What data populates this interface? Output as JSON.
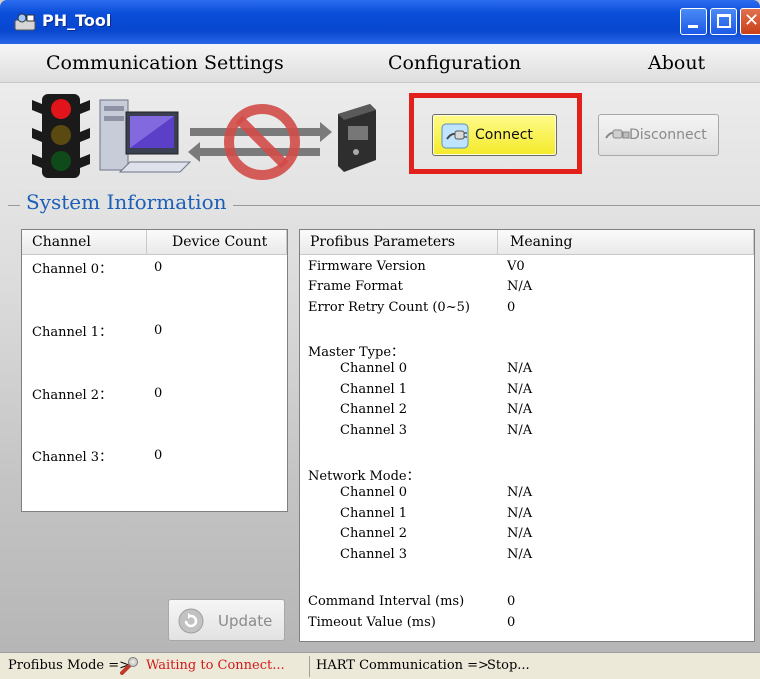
{
  "window": {
    "title": "PH_Tool"
  },
  "menu": [
    "Communication Settings",
    "Configuration",
    "About"
  ],
  "toolbar": {
    "connect_label": "Connect",
    "disconnect_label": "Disconnect"
  },
  "system_info": {
    "title": "System Information",
    "channels": {
      "headers": [
        "Channel",
        "Device Count"
      ],
      "rows": [
        {
          "channel": "Channel 0：",
          "count": "0"
        },
        {
          "channel": "Channel 1：",
          "count": "0"
        },
        {
          "channel": "Channel 2：",
          "count": "0"
        },
        {
          "channel": "Channel 3：",
          "count": "0"
        }
      ]
    },
    "params": {
      "headers": [
        "Profibus Parameters",
        "Meaning"
      ],
      "firmware": {
        "label": "Firmware Version",
        "value": "V0"
      },
      "frame": {
        "label": "Frame Format",
        "value": "N/A"
      },
      "retry": {
        "label": "Error Retry Count (0~5)",
        "value": "0"
      },
      "master_type": {
        "label": "Master Type：",
        "rows": [
          {
            "label": "Channel 0",
            "value": "N/A"
          },
          {
            "label": "Channel 1",
            "value": "N/A"
          },
          {
            "label": "Channel 2",
            "value": "N/A"
          },
          {
            "label": "Channel 3",
            "value": "N/A"
          }
        ]
      },
      "network_mode": {
        "label": "Network Mode：",
        "rows": [
          {
            "label": "Channel 0",
            "value": "N/A"
          },
          {
            "label": "Channel 1",
            "value": "N/A"
          },
          {
            "label": "Channel 2",
            "value": "N/A"
          },
          {
            "label": "Channel 3",
            "value": "N/A"
          }
        ]
      },
      "command_interval": {
        "label": "Command Interval (ms)",
        "value": "0"
      },
      "timeout": {
        "label": "Timeout Value (ms)",
        "value": "0"
      }
    },
    "update_label": "Update"
  },
  "status": {
    "profibus_label": "Profibus Mode =>",
    "profibus_value": "Waiting to Connect...",
    "hart_label": "HART Communication =>",
    "hart_value": "Stop..."
  },
  "colors": {
    "accent_red": "#e2211c",
    "title_blue": "#1b5fb8",
    "connect_yellow": "#f4ea2a",
    "status_red": "#d11a1a"
  },
  "icons": [
    "app-icon",
    "traffic-light-icon",
    "computer-icon",
    "disconnected-link-icon",
    "device-icon",
    "plug-icon",
    "unplug-icon",
    "refresh-icon",
    "wrench-icon"
  ]
}
